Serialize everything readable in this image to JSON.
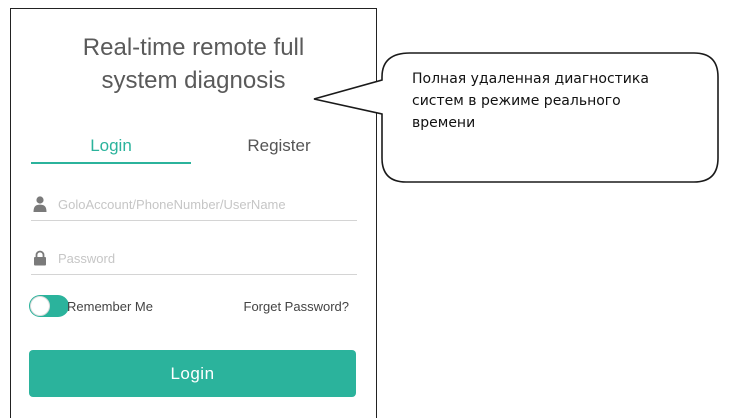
{
  "app": {
    "title_line1": "Real-time remote full",
    "title_line2": "system diagnosis"
  },
  "tabs": [
    {
      "label": "Login",
      "active": true
    },
    {
      "label": "Register",
      "active": false
    }
  ],
  "form": {
    "account_placeholder": "GoloAccount/PhoneNumber/UserName",
    "account_value": "",
    "password_placeholder": "Password",
    "password_value": "",
    "remember_label": "Remember Me",
    "remember_on": true,
    "forget_label": "Forget Password?",
    "login_button": "Login"
  },
  "callout": {
    "line1": "Полная удаленная диагностика",
    "line2": "систем в режиме реального",
    "line3": "времени"
  },
  "colors": {
    "accent": "#2bb39c",
    "title_text": "#5a5a5a",
    "placeholder": "#c6c6c6"
  }
}
